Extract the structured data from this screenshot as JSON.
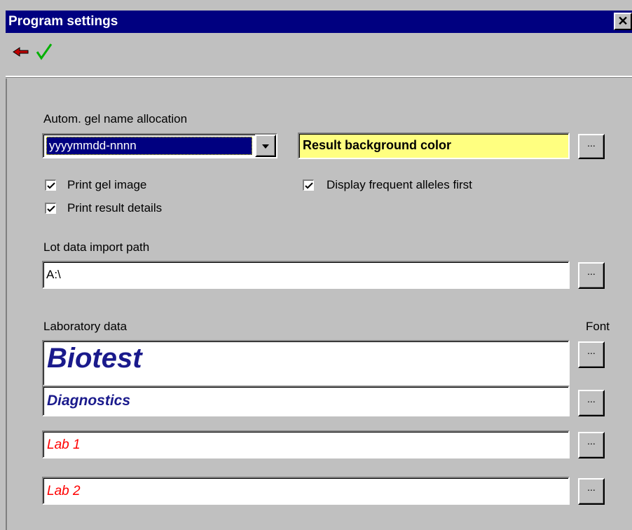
{
  "window": {
    "title": "Program settings"
  },
  "toolbar": {
    "back_icon": "back-arrow-icon",
    "ok_icon": "checkmark-icon"
  },
  "gel_name": {
    "label": "Autom. gel name allocation",
    "value": "yyyymmdd-nnnn"
  },
  "result_color": {
    "label": "Result background color",
    "color": "#ffff80"
  },
  "checkboxes": {
    "print_gel_image": {
      "label": "Print gel image",
      "checked": true
    },
    "print_result_details": {
      "label": "Print result details",
      "checked": true
    },
    "display_frequent_alleles": {
      "label": "Display frequent alleles first",
      "checked": true
    }
  },
  "lot_data": {
    "label": "Lot data import path",
    "value": "A:\\"
  },
  "lab_data": {
    "label": "Laboratory data",
    "font_label": "Font",
    "lines": [
      {
        "value": "Biotest",
        "color": "#1a1a8c"
      },
      {
        "value": "Diagnostics",
        "color": "#1a1a8c"
      },
      {
        "value": "Lab 1",
        "color": "#ff0000"
      },
      {
        "value": "Lab 2",
        "color": "#ff0000"
      }
    ]
  },
  "browse_label": "..."
}
